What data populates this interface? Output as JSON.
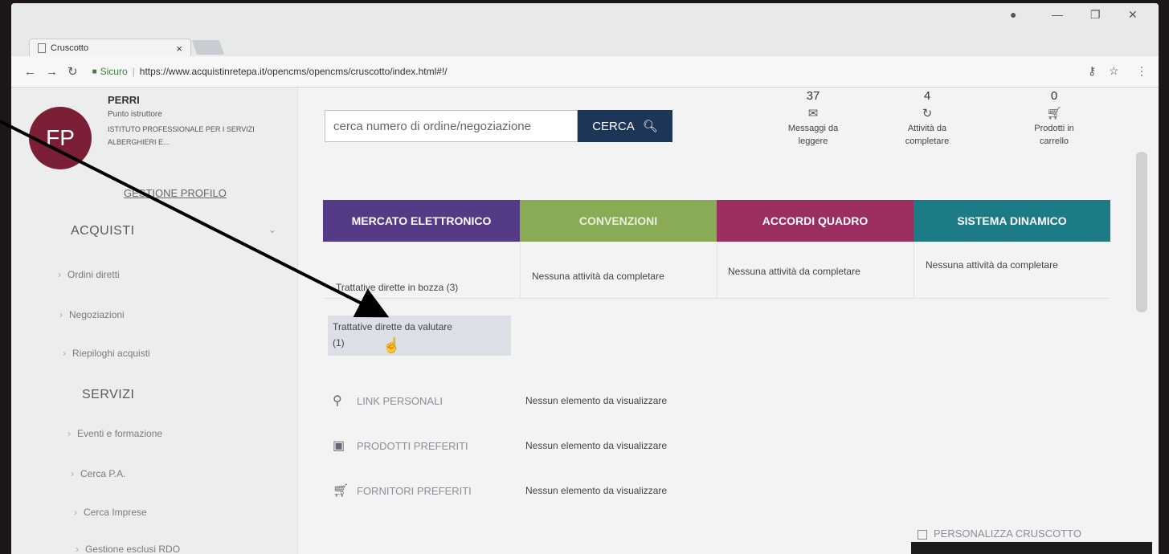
{
  "browser": {
    "tab_title": "Cruscotto",
    "tab_close": "×",
    "secure_label": "Sicuro",
    "url": "https://www.acquistinretepa.it/opencms/opencms/cruscotto/index.html#!/"
  },
  "profile": {
    "initials": "FP",
    "name": "PERRI",
    "role": "Punto istruttore",
    "org": "ISTITUTO PROFESSIONALE PER I SERVIZI ALBERGHIERI E...",
    "manage_link": "GESTIONE PROFILO"
  },
  "sidebar": {
    "acquisti_header": "ACQUISTI",
    "acquisti_items": [
      "Ordini diretti",
      "Negoziazioni",
      "Riepiloghi acquisti"
    ],
    "servizi_header": "SERVIZI",
    "servizi_items": [
      "Eventi e formazione",
      "Cerca P.A.",
      "Cerca Imprese",
      "Gestione esclusi RDO"
    ]
  },
  "search": {
    "placeholder": "cerca numero di ordine/negoziazione",
    "button_label": "CERCA"
  },
  "stats": [
    {
      "count": "37",
      "label1": "Messaggi da",
      "label2": "leggere",
      "icon": "envelope-icon"
    },
    {
      "count": "4",
      "label1": "Attività da",
      "label2": "completare",
      "icon": "refresh-icon"
    },
    {
      "count": "0",
      "label1": "Prodotti in",
      "label2": "carrello",
      "icon": "cart-icon"
    }
  ],
  "categories": [
    {
      "label": "MERCATO ELETTRONICO",
      "color": "#553a86"
    },
    {
      "label": "CONVENZIONI",
      "color": "#8aab55"
    },
    {
      "label": "ACCORDI QUADRO",
      "color": "#9b2e60"
    },
    {
      "label": "SISTEMA DINAMICO",
      "color": "#1d7b86"
    }
  ],
  "mepa": {
    "bozza": "Trattative dirette in bozza (3)",
    "valutare_line1": "Trattative dirette da valutare",
    "valutare_line2": "(1)"
  },
  "no_activity": "Nessuna attività da completare",
  "lists": [
    {
      "label": "LINK PERSONALI",
      "value": "Nessun elemento da visualizzare"
    },
    {
      "label": "PRODOTTI PREFERITI",
      "value": "Nessun elemento da visualizzare"
    },
    {
      "label": "FORNITORI PREFERITI",
      "value": "Nessun elemento da visualizzare"
    }
  ],
  "personalizza": "PERSONALIZZA CRUSCOTTO"
}
